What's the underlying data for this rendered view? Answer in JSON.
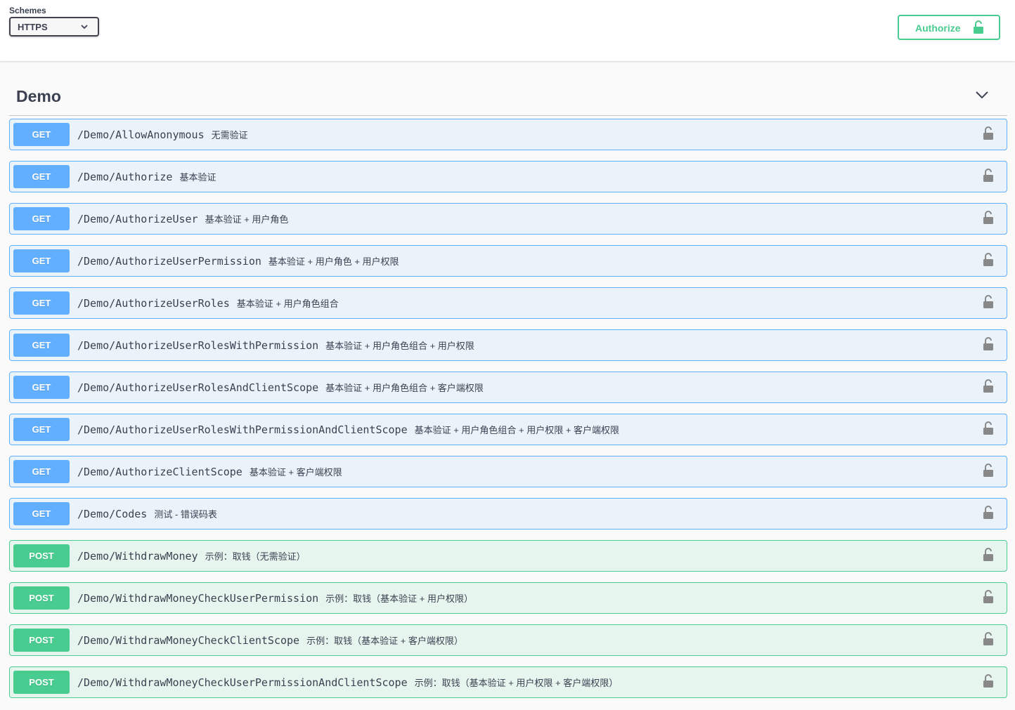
{
  "topbar": {
    "schemes_label": "Schemes",
    "scheme_selected": "HTTPS",
    "authorize_label": "Authorize"
  },
  "tag": {
    "title": "Demo"
  },
  "colors": {
    "get": "#61affe",
    "post": "#49cc90",
    "text": "#3b4151"
  },
  "operations": [
    {
      "method": "GET",
      "path": "/Demo/AllowAnonymous",
      "summary": "无需验证"
    },
    {
      "method": "GET",
      "path": "/Demo/Authorize",
      "summary": "基本验证"
    },
    {
      "method": "GET",
      "path": "/Demo/AuthorizeUser",
      "summary": "基本验证 + 用户角色"
    },
    {
      "method": "GET",
      "path": "/Demo/AuthorizeUserPermission",
      "summary": "基本验证 + 用户角色 + 用户权限"
    },
    {
      "method": "GET",
      "path": "/Demo/AuthorizeUserRoles",
      "summary": "基本验证 + 用户角色组合"
    },
    {
      "method": "GET",
      "path": "/Demo/AuthorizeUserRolesWithPermission",
      "summary": "基本验证 + 用户角色组合 + 用户权限"
    },
    {
      "method": "GET",
      "path": "/Demo/AuthorizeUserRolesAndClientScope",
      "summary": "基本验证 + 用户角色组合 + 客户端权限"
    },
    {
      "method": "GET",
      "path": "/Demo/AuthorizeUserRolesWithPermissionAndClientScope",
      "summary": "基本验证 + 用户角色组合 + 用户权限 + 客户端权限"
    },
    {
      "method": "GET",
      "path": "/Demo/AuthorizeClientScope",
      "summary": "基本验证 + 客户端权限"
    },
    {
      "method": "GET",
      "path": "/Demo/Codes",
      "summary": "测试 - 错误码表"
    },
    {
      "method": "POST",
      "path": "/Demo/WithdrawMoney",
      "summary": "示例：取钱（无需验证）"
    },
    {
      "method": "POST",
      "path": "/Demo/WithdrawMoneyCheckUserPermission",
      "summary": "示例：取钱（基本验证 + 用户权限）"
    },
    {
      "method": "POST",
      "path": "/Demo/WithdrawMoneyCheckClientScope",
      "summary": "示例：取钱（基本验证 + 客户端权限）"
    },
    {
      "method": "POST",
      "path": "/Demo/WithdrawMoneyCheckUserPermissionAndClientScope",
      "summary": "示例：取钱（基本验证 + 用户权限 + 客户端权限）"
    }
  ]
}
